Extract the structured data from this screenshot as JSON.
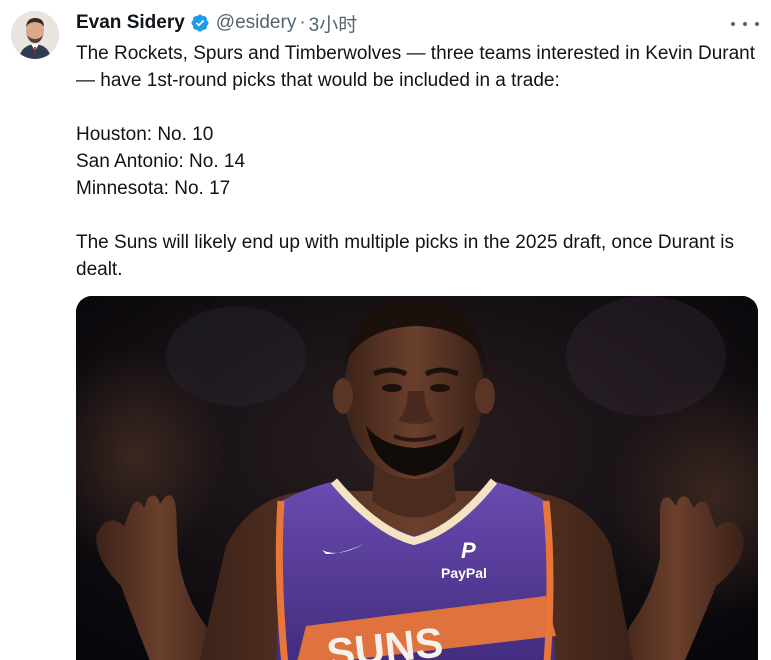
{
  "tweet": {
    "author": {
      "display_name": "Evan Sidery",
      "verified_icon": "verified-badge-icon",
      "handle": "@esidery",
      "separator": "·",
      "time": "3小时",
      "avatar_icon": "user-avatar"
    },
    "more_icon": "more-options-icon",
    "text": {
      "line1": "The Rockets, Spurs and Timberwolves — three teams interested in Kevin Durant — have 1st-round picks that would be included in a trade:",
      "pick1": "Houston: No. 10",
      "pick2": "San Antonio: No. 14",
      "pick3": "Minnesota: No. 17",
      "closing": "The Suns will likely end up with multiple picks in the 2025 draft, once Durant is dealt."
    },
    "media": {
      "jersey_sponsor": "PayPal",
      "jersey_text": "SUNS"
    }
  },
  "colors": {
    "accent": "#1d9bf0",
    "text": "#0f1419",
    "secondary": "#536471",
    "jersey_purple": "#5a3e9a",
    "jersey_orange": "#e8763a"
  }
}
